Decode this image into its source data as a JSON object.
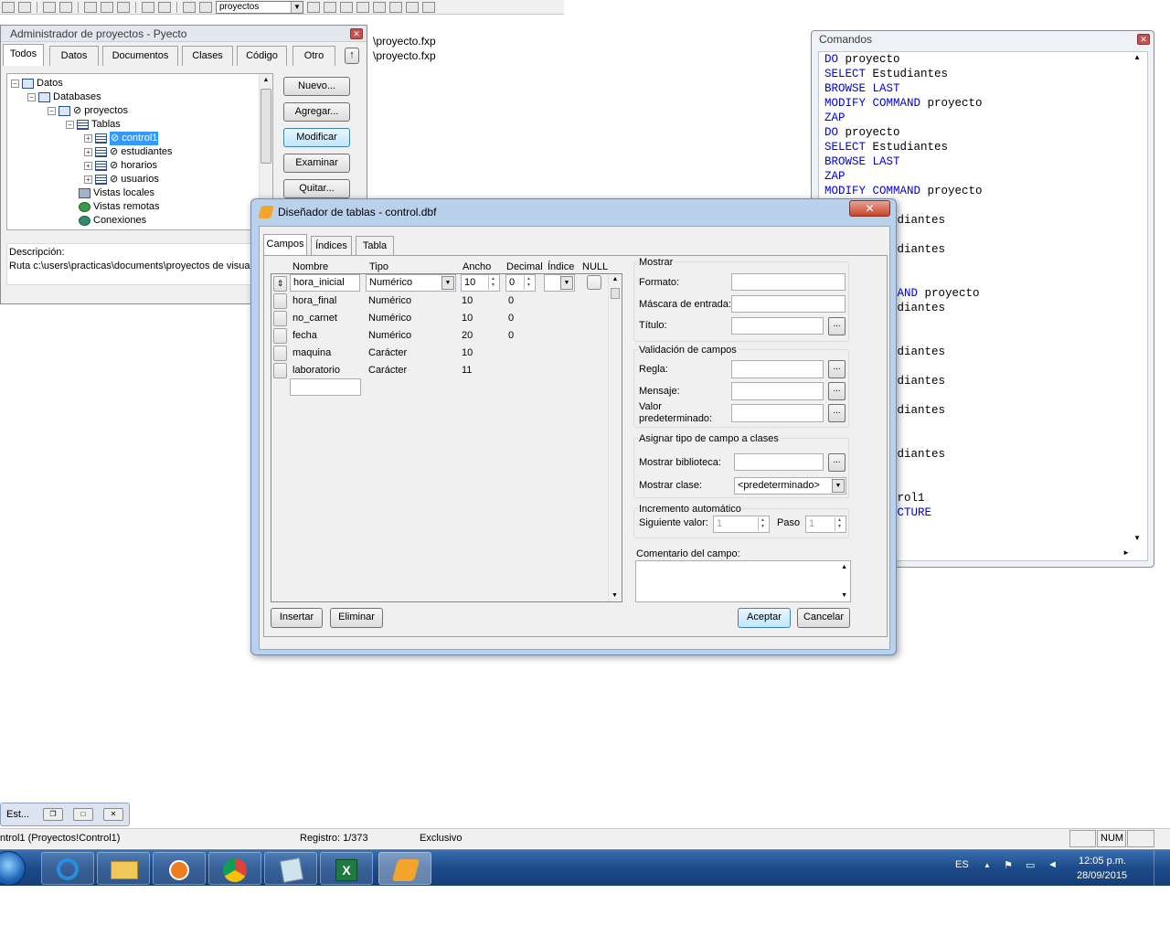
{
  "toolbar": {
    "combo_value": "proyectos"
  },
  "project_manager": {
    "title": "Administrador de proyectos - Pyecto",
    "tabs": [
      "Todos",
      "Datos",
      "Documentos",
      "Clases",
      "Código",
      "Otro"
    ],
    "tab_more": "↑",
    "tree": {
      "datos": "Datos",
      "databases": "Databases",
      "proyectos": "⊘ proyectos",
      "tablas": "Tablas",
      "control1": "⊘ control1",
      "estudiantes": "⊘ estudiantes",
      "horarios": "⊘ horarios",
      "usuarios": "⊘ usuarios",
      "vistas_locales": "Vistas locales",
      "vistas_remotas": "Vistas remotas",
      "conexiones": "Conexiones"
    },
    "buttons": {
      "nuevo": "Nuevo...",
      "agregar": "Agregar...",
      "modificar": "Modificar",
      "examinar": "Examinar",
      "quitar": "Quitar..."
    },
    "descripcion_label": "Descripción:",
    "ruta": "Ruta c:\\users\\practicas\\documents\\proyectos de visua"
  },
  "output_lines": [
    "\\proyecto.fxp",
    "\\proyecto.fxp"
  ],
  "commands": {
    "title": "Comandos",
    "lines": [
      {
        "kw": "DO",
        "rest": " proyecto"
      },
      {
        "kw": "SELECT",
        "rest": " Estudiantes"
      },
      {
        "kw": "BROWSE LAST",
        "rest": ""
      },
      {
        "kw": "MODIFY COMMAND",
        "rest": " proyecto"
      },
      {
        "kw": "ZAP",
        "rest": ""
      },
      {
        "kw": "DO",
        "rest": " proyecto"
      },
      {
        "kw": "SELECT",
        "rest": " Estudiantes"
      },
      {
        "kw": "BROWSE LAST",
        "rest": ""
      },
      {
        "kw": "ZAP",
        "rest": ""
      },
      {
        "kw": "MODIFY COMMAND",
        "rest": " proyecto"
      }
    ],
    "partial_lines": [
      {
        "kw": "",
        "rest": "o"
      },
      {
        "kw": "",
        "rest": "udiantes"
      },
      {
        "kw": "T",
        "rest": ""
      },
      {
        "kw": "",
        "rest": "udiantes"
      },
      {
        "kw": "T",
        "rest": ""
      },
      {
        "kw": "",
        "rest": ""
      },
      {
        "kw": "MAND",
        "rest": " proyecto"
      },
      {
        "kw": "",
        "rest": "udiantes"
      },
      {
        "kw": "T",
        "rest": ""
      },
      {
        "kw": "",
        "rest": "o"
      },
      {
        "kw": "",
        "rest": "udiantes"
      },
      {
        "kw": "T",
        "rest": ""
      },
      {
        "kw": "",
        "rest": "udiantes"
      },
      {
        "kw": "T",
        "rest": ""
      },
      {
        "kw": "",
        "rest": "udiantes"
      },
      {
        "kw": "T",
        "rest": ""
      },
      {
        "kw": "",
        "rest": ""
      },
      {
        "kw": "",
        "rest": "udiantes"
      },
      {
        "kw": "T",
        "rest": ""
      },
      {
        "kw": "",
        "rest": "o"
      },
      {
        "kw": "",
        "rest": "trol1"
      },
      {
        "kw": "UCTURE",
        "rest": ""
      }
    ]
  },
  "designer": {
    "title": "Diseñador de tablas - control.dbf",
    "tabs": [
      "Campos",
      "Índices",
      "Tabla"
    ],
    "headers": {
      "nombre": "Nombre",
      "tipo": "Tipo",
      "ancho": "Ancho",
      "decimal": "Decimal",
      "indice": "Índice",
      "null": "NULL"
    },
    "fields": [
      {
        "nombre": "hora_inicial",
        "tipo": "Numérico",
        "ancho": "10",
        "decimal": "0"
      },
      {
        "nombre": "hora_final",
        "tipo": "Numérico",
        "ancho": "10",
        "decimal": "0"
      },
      {
        "nombre": "no_carnet",
        "tipo": "Numérico",
        "ancho": "10",
        "decimal": "0"
      },
      {
        "nombre": "fecha",
        "tipo": "Numérico",
        "ancho": "20",
        "decimal": "0"
      },
      {
        "nombre": "maquina",
        "tipo": "Carácter",
        "ancho": "10",
        "decimal": ""
      },
      {
        "nombre": "laboratorio",
        "tipo": "Carácter",
        "ancho": "11",
        "decimal": ""
      }
    ],
    "mostrar": {
      "group": "Mostrar",
      "formato": "Formato:",
      "mascara": "Máscara de entrada:",
      "titulo": "Título:"
    },
    "validacion": {
      "group": "Validación de campos",
      "regla": "Regla:",
      "mensaje": "Mensaje:",
      "valor": "Valor",
      "predeterminado": "predeterminado:"
    },
    "asignar": {
      "group": "Asignar tipo de campo a clases",
      "biblioteca": "Mostrar biblioteca:",
      "clase": "Mostrar clase:",
      "clase_value": "<predeterminado>"
    },
    "incremento": {
      "group": "Incremento automático",
      "siguiente": "Siguiente valor:",
      "siguiente_value": "1",
      "paso": "Paso",
      "paso_value": "1"
    },
    "comentario": "Comentario del campo:",
    "buttons": {
      "insertar": "Insertar",
      "eliminar": "Eliminar",
      "aceptar": "Aceptar",
      "cancelar": "Cancelar"
    }
  },
  "minimized": {
    "label": "Est..."
  },
  "status": {
    "left": "ntrol1 (Proyectos!Control1)",
    "registro": "Registro: 1/373",
    "modo": "Exclusivo",
    "num": "NUM"
  },
  "tray": {
    "lang": "ES",
    "time": "12:05 p.m.",
    "date": "28/09/2015"
  }
}
